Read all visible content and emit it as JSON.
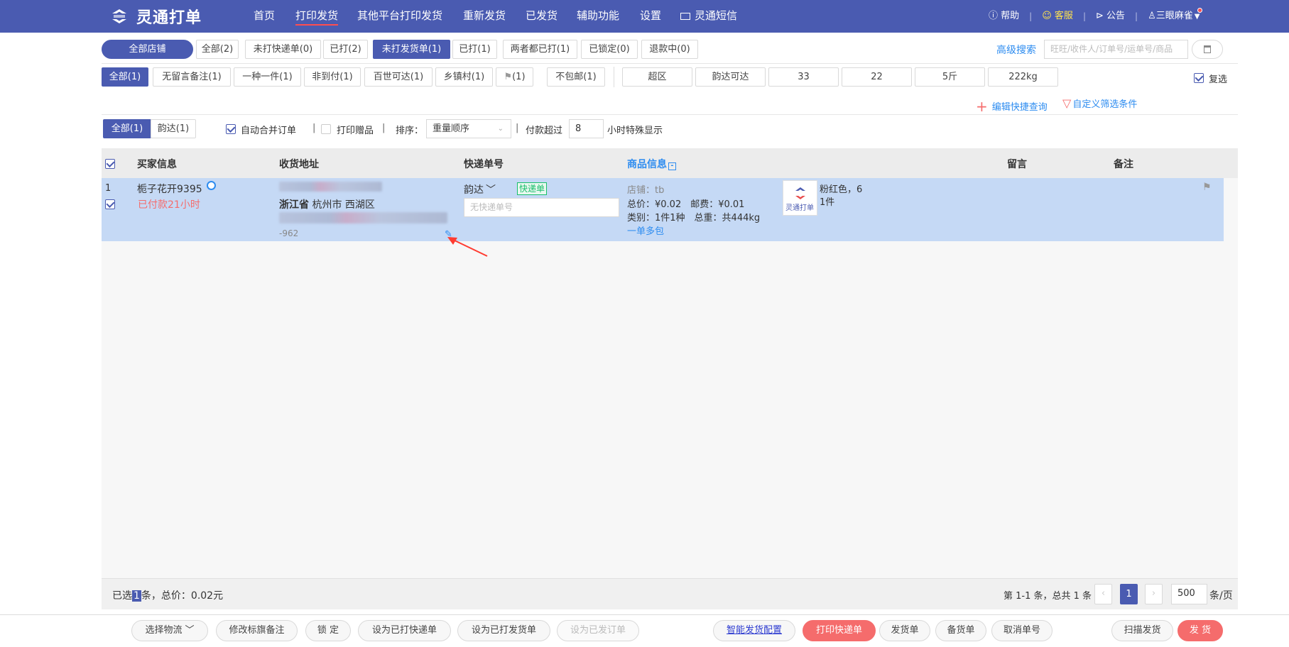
{
  "topbar": {
    "brand": "灵通打单",
    "nav": [
      "首页",
      "打印发货",
      "其他平台打印发货",
      "重新发货",
      "已发货",
      "辅助功能",
      "设置",
      "灵通短信"
    ],
    "help": "帮助",
    "service": "客服",
    "notice": "公告",
    "user": "三眼麻雀"
  },
  "status_tabs": [
    "全部店铺",
    "全部(2)",
    "未打快递单(0)",
    "已打(2)",
    "未打发货单(1)",
    "已打(1)",
    "两者都已打(1)",
    "已锁定(0)",
    "退款中(0)"
  ],
  "search": {
    "advanced": "高级搜索",
    "placeholder": "旺旺/收件人/订单号/运单号/商品"
  },
  "filter_tabs": [
    "全部(1)",
    "无留言备注(1)",
    "一种一件(1)",
    "非到付(1)",
    "百世可达(1)",
    "乡镇村(1)",
    "(1)",
    "不包邮(1)"
  ],
  "filter_boxes": [
    "超区",
    "韵达可达",
    "33",
    "22",
    "5斤",
    "222kg"
  ],
  "multi_select": "复选",
  "quick_query": "编辑快捷查询",
  "custom_filter": "自定义筛选条件",
  "express_tabs": [
    "全部(1)",
    "韵达(1)"
  ],
  "auto_merge": "自动合并订单",
  "print_gift": "打印赠品",
  "sort_label": "排序：",
  "sort_value": "重量顺序",
  "pay_over_label": "付款超过",
  "pay_over_value": "8",
  "pay_over_suffix": "小时特殊显示",
  "table_headers": [
    "买家信息",
    "收货地址",
    "快递单号",
    "商品信息",
    "留言",
    "备注"
  ],
  "row": {
    "index": "1",
    "buyer": "栀子花开9395",
    "paid": "已付款21小时",
    "address_region": "浙江省",
    "address_city": "杭州市 西湖区",
    "address_tail": "-962",
    "express": "韵达",
    "express_tag": "快递单",
    "express_placeholder": "无快递单号",
    "shop": "店铺：tb",
    "price": "总价：¥0.02　邮费：¥0.01",
    "category": "类别：1件1种　总重：共444kg",
    "multi_pack": "一单多包",
    "thumb_brand": "灵通打单",
    "sku": "粉红色，6",
    "qty": "1件"
  },
  "footer": {
    "selected_prefix": "已选",
    "selected_count": "1",
    "selected_suffix": "条，总价：0.02元",
    "page_info": "第 1-1 条，总共 1 条",
    "current_page": "1",
    "page_size": "500",
    "page_unit": "条/页"
  },
  "actions": {
    "choose_logistics": "选择物流",
    "edit_flag": "修改标旗备注",
    "lock": "锁 定",
    "set_printed_express": "设为已打快递单",
    "set_printed_delivery": "设为已打发货单",
    "set_shipped": "设为已发订单",
    "smart_config": "智能发货配置",
    "print_express": "打印快递单",
    "delivery_note": "发货单",
    "stock_note": "备货单",
    "cancel_number": "取消单号",
    "scan_ship": "扫描发货",
    "ship": "发 货"
  },
  "colors": {
    "brand": "#4a5bb1",
    "selected_row": "#c5d9f5",
    "accent_red": "#f56c6c",
    "link": "#2d8cf0"
  }
}
